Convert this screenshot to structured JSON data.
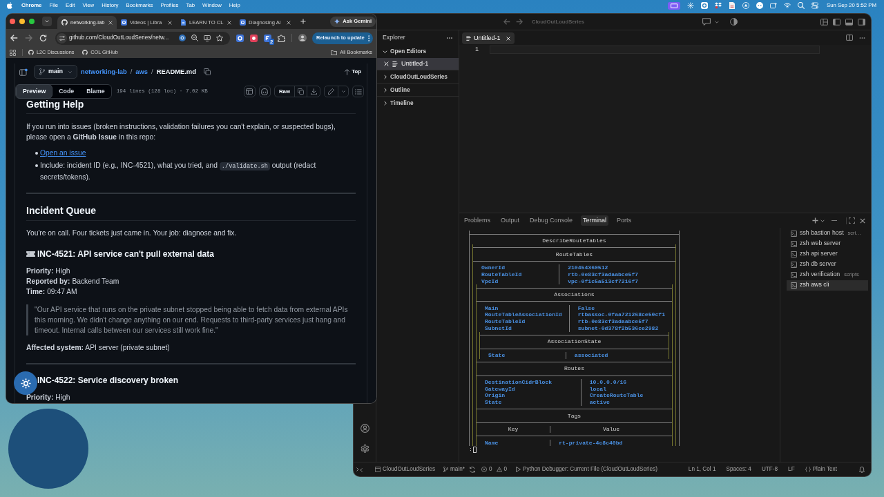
{
  "menu_bar": {
    "app": "Chrome",
    "menus": [
      "File",
      "Edit",
      "View",
      "History",
      "Bookmarks",
      "Profiles",
      "Tab",
      "Window",
      "Help"
    ],
    "clock": "Sun Sep 20 5:52 PM"
  },
  "browser": {
    "tabs": [
      {
        "kind": "repo",
        "title": "networking-lab",
        "selected": true
      },
      {
        "kind": "app",
        "title": "Videos | Libra",
        "selected": false
      },
      {
        "kind": "doc",
        "title": "LEARN TO CL",
        "selected": false
      },
      {
        "kind": "app",
        "title": "Diagnosing Al",
        "selected": false
      }
    ],
    "ask_button": "Ask Gemini",
    "nav": [
      {
        "kind": "back",
        "disabled": false
      },
      {
        "kind": "forward",
        "disabled": true
      },
      {
        "kind": "reload",
        "disabled": false
      }
    ],
    "url": "github.com/CloudOutLoudSeries/netw...",
    "extension_badge": "2",
    "relaunch_button": "Relaunch to update",
    "bookmarks": [
      "L2C Discussions",
      "COL GitHub"
    ],
    "all_bookmarks": "All Bookmarks"
  },
  "repo_header": {
    "branch": "main",
    "breadcrumb": [
      {
        "kind": "link",
        "text": "networking-lab"
      },
      {
        "kind": "separator",
        "text": "/"
      },
      {
        "kind": "link",
        "text": "aws"
      },
      {
        "kind": "separator",
        "text": "/"
      },
      {
        "kind": "current",
        "text": "README.md"
      }
    ],
    "top_button": "Top",
    "view_tabs": [
      {
        "label": "Preview",
        "selected": true
      },
      {
        "label": "Code",
        "selected": false
      },
      {
        "label": "Blame",
        "selected": false
      }
    ],
    "file_info": "194 lines (128 loc) · 7.02 KB",
    "raw_button": "Raw"
  },
  "readme": {
    "getting_help": {
      "heading": "Getting Help",
      "intro": "If you run into issues (broken instructions, validation failures you can't explain, or suspected bugs), please open a **GitHub Issue** in this repo:",
      "bullets": [
        {
          "kind": "link",
          "text": "Open an issue"
        },
        {
          "kind": "text",
          "before": "Include: incident ID (e.g., INC-4521), what you tried, and ",
          "code": "./validate.sh",
          "after": " output (redact secrets/tokens)."
        }
      ]
    },
    "incident_queue": {
      "heading": "Incident Queue",
      "intro": "You're on call. Four tickets just came in. Your job: diagnose and fix.",
      "incidents": [
        {
          "ticket_icon": true,
          "title": "INC-4521: API service can't pull external data",
          "details": [
            "**Priority:** High",
            "**Reported by:** Backend Team",
            "**Time:** 09:47 AM"
          ],
          "quote": "\"Our API service that runs on the private subnet stopped being able to fetch data from external APIs this morning. We didn't change anything on our end. Requests to third-party services just hang and timeout. Internal calls between our services still work fine.\"",
          "affected": "**Affected system:** API server (private subnet)"
        },
        {
          "ticket_icon": false,
          "title": "INC-4522: Service discovery broken",
          "details": [
            "**Priority:** High"
          ]
        }
      ]
    }
  },
  "vscode": {
    "title": "CloudOutLoudSeries",
    "explorer": {
      "title": "Explorer",
      "sections": [
        {
          "label": "Open Editors",
          "expanded": true,
          "items": [
            {
              "label": "Untitled-1",
              "selected": true
            }
          ]
        },
        {
          "label": "CloudOutLoudSeries",
          "expanded": false
        },
        {
          "label": "Outline",
          "expanded": false
        },
        {
          "label": "Timeline",
          "expanded": false
        }
      ]
    },
    "editor_tabs": [
      {
        "label": "Untitled-1",
        "selected": true
      }
    ],
    "lines": [
      {
        "number": "1",
        "current": true
      }
    ],
    "panel_tabs": [
      {
        "label": "Problems",
        "selected": false
      },
      {
        "label": "Output",
        "selected": false
      },
      {
        "label": "Debug Console",
        "selected": false
      },
      {
        "label": "Terminal",
        "selected": true
      },
      {
        "label": "Ports",
        "selected": false
      }
    ],
    "terminal": {
      "title": "DescribeRouteTables",
      "sections": [
        {
          "heading": "RouteTables",
          "rows": [
            {
              "key": "OwnerId",
              "value": "210454360512"
            },
            {
              "key": "RouteTableId",
              "value": "rtb-0e83cf3adaabce5f7"
            },
            {
              "key": "VpcId",
              "value": "vpc-0f1c5a513cf7216f7"
            }
          ],
          "children": [
            {
              "heading": "Associations",
              "rows": [
                {
                  "key": "Main",
                  "value": "False"
                },
                {
                  "key": "RouteTableAssociationId",
                  "value": "rtbassoc-0faa721268ce50cf1"
                },
                {
                  "key": "RouteTableId",
                  "value": "rtb-0e83cf3adaabce5f7"
                },
                {
                  "key": "SubnetId",
                  "value": "subnet-0d378f2b536ce2982"
                }
              ],
              "children": [
                {
                  "heading": "AssociationState",
                  "rows": [
                    {
                      "key": "State",
                      "value": "associated"
                    }
                  ]
                }
              ]
            },
            {
              "heading": "Routes",
              "rows": [
                {
                  "key": "DestinationCidrBlock",
                  "value": "10.0.0.0/16"
                },
                {
                  "key": "GatewayId",
                  "value": "local"
                },
                {
                  "key": "Origin",
                  "value": "CreateRouteTable"
                },
                {
                  "key": "State",
                  "value": "active"
                }
              ]
            },
            {
              "heading": "Tags",
              "columns": [
                "Key",
                "Value"
              ],
              "rows": [
                {
                  "key": "Name",
                  "value": "rt-private-4c8c40bd"
                }
              ]
            }
          ]
        }
      ],
      "prompt": ":"
    },
    "terminal_list": [
      {
        "name": "ssh bastion host",
        "detail": "scri…",
        "selected": false
      },
      {
        "name": "zsh web server",
        "selected": false
      },
      {
        "name": "zsh api server",
        "selected": false
      },
      {
        "name": "zsh db server",
        "selected": false
      },
      {
        "name": "zsh verification",
        "detail": "scripts",
        "selected": false
      },
      {
        "name": "zsh aws cli",
        "selected": true
      }
    ],
    "status_bar": {
      "folder": "CloudOutLoudSeries",
      "branch": "main*",
      "errors": "0",
      "warnings": "0",
      "run_config": "Python Debugger: Current File (CloudOutLoudSeries)",
      "items": [
        "Ln 1, Col 1",
        "Spaces: 4",
        "UTF-8",
        "LF"
      ],
      "language": "Plain Text"
    }
  }
}
